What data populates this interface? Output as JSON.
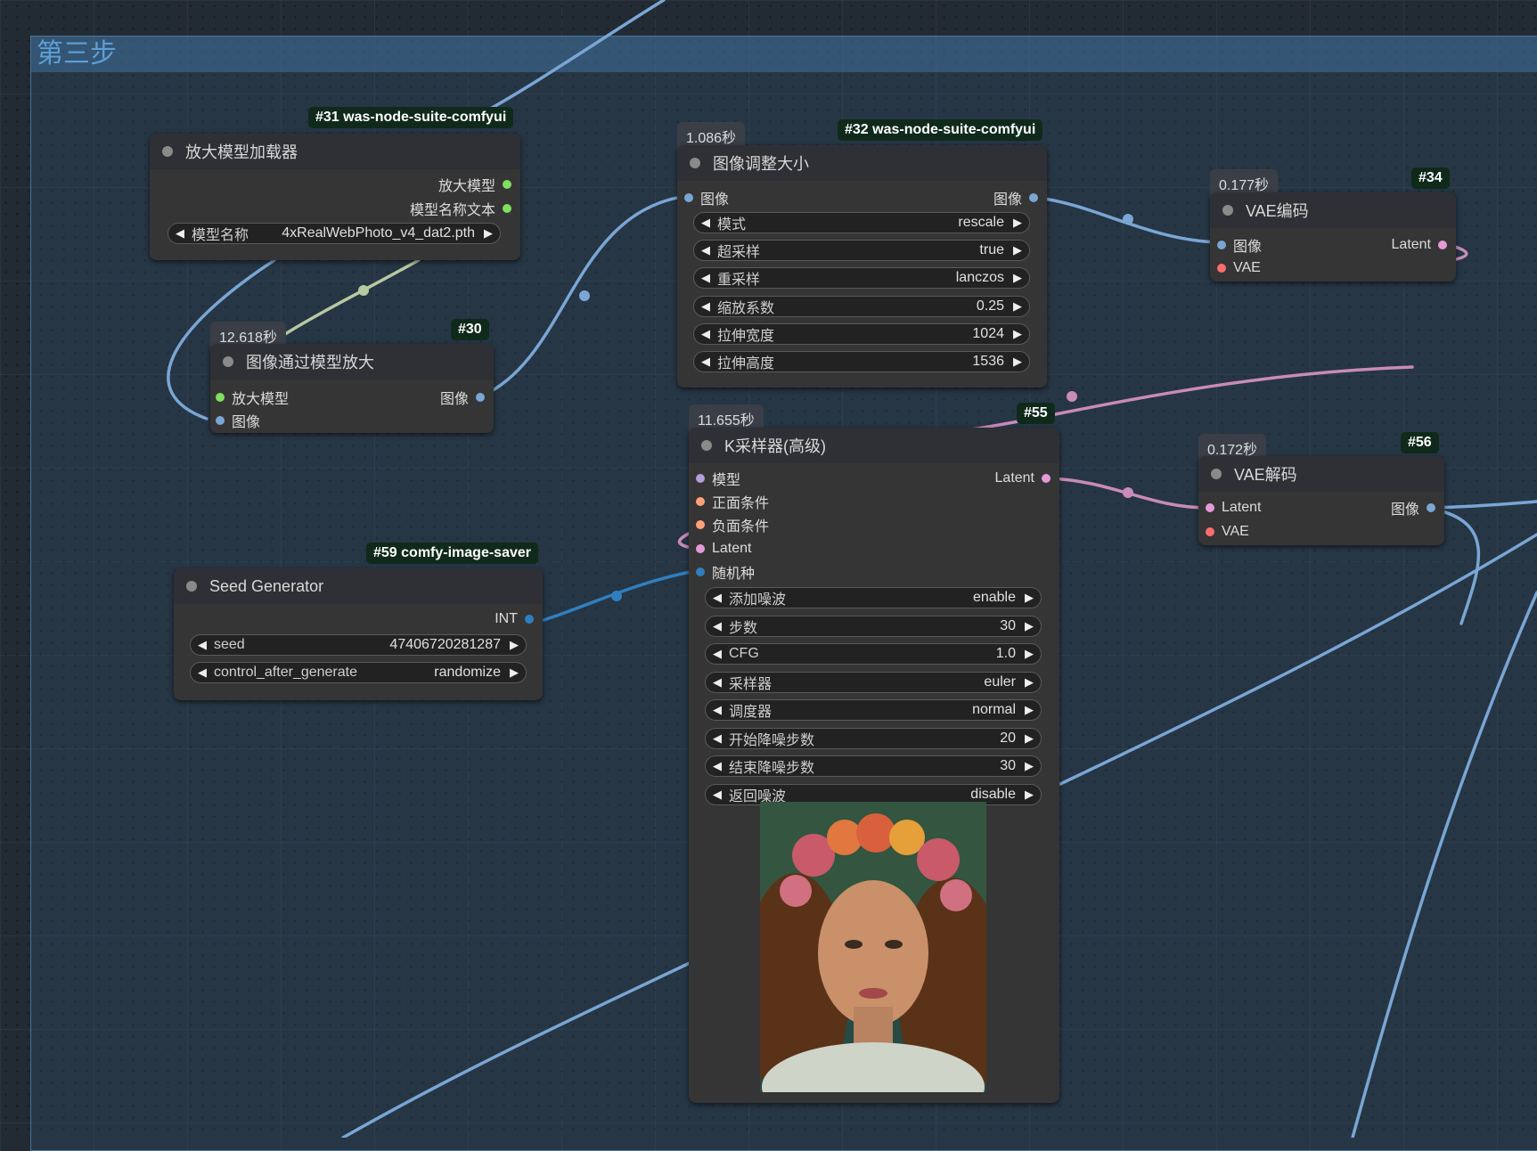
{
  "group": {
    "title": "第三步"
  },
  "colors": {
    "wire_image": "#7aa6d4",
    "wire_latent": "#c98bb9",
    "wire_upscale": "#b7c9a0",
    "wire_int": "#2f7fc0",
    "slot_green": "#7ee05f",
    "slot_image": "#7aa6d4",
    "slot_vae": "#ff6e6e",
    "slot_latent": "#e39ad6",
    "slot_model": "#b39ddb",
    "slot_cond": "#ffa07a",
    "slot_int": "#2f7fc0"
  },
  "nodes": {
    "upscale_loader": {
      "badge": "#31 was-node-suite-comfyui",
      "title": "放大模型加载器",
      "outputs": [
        "放大模型",
        "模型名称文本"
      ],
      "widgets": [
        {
          "label": "模型名称",
          "value": "4xRealWebPhoto_v4_dat2.pth"
        }
      ]
    },
    "upscale_with_model": {
      "badge": "#30",
      "timing": "12.618秒",
      "title": "图像通过模型放大",
      "inputs": [
        "放大模型",
        "图像"
      ],
      "outputs": [
        "图像"
      ]
    },
    "image_resize": {
      "badge": "#32 was-node-suite-comfyui",
      "timing": "1.086秒",
      "title": "图像调整大小",
      "inputs": [
        "图像"
      ],
      "outputs": [
        "图像"
      ],
      "widgets": [
        {
          "label": "模式",
          "value": "rescale"
        },
        {
          "label": "超采样",
          "value": "true"
        },
        {
          "label": "重采样",
          "value": "lanczos"
        },
        {
          "label": "缩放系数",
          "value": "0.25"
        },
        {
          "label": "拉伸宽度",
          "value": "1024"
        },
        {
          "label": "拉伸高度",
          "value": "1536"
        }
      ]
    },
    "vae_encode": {
      "badge": "#34",
      "timing": "0.177秒",
      "title": "VAE编码",
      "inputs": [
        "图像",
        "VAE"
      ],
      "outputs": [
        "Latent"
      ]
    },
    "ksampler": {
      "badge": "#55",
      "timing": "11.655秒",
      "title": "K采样器(高级)",
      "inputs": [
        "模型",
        "正面条件",
        "负面条件",
        "Latent",
        "随机种"
      ],
      "outputs": [
        "Latent"
      ],
      "widgets": [
        {
          "label": "添加噪波",
          "value": "enable"
        },
        {
          "label": "步数",
          "value": "30"
        },
        {
          "label": "CFG",
          "value": "1.0"
        },
        {
          "label": "采样器",
          "value": "euler"
        },
        {
          "label": "调度器",
          "value": "normal"
        },
        {
          "label": "开始降噪步数",
          "value": "20"
        },
        {
          "label": "结束降噪步数",
          "value": "30"
        },
        {
          "label": "返回噪波",
          "value": "disable"
        }
      ]
    },
    "vae_decode": {
      "badge": "#56",
      "timing": "0.172秒",
      "title": "VAE解码",
      "inputs": [
        "Latent",
        "VAE"
      ],
      "outputs": [
        "图像"
      ]
    },
    "seed_generator": {
      "badge": "#59 comfy-image-saver",
      "title": "Seed Generator",
      "outputs": [
        "INT"
      ],
      "widgets": [
        {
          "label": "seed",
          "value": "47406720281287"
        },
        {
          "label": "control_after_generate",
          "value": "randomize"
        }
      ]
    }
  }
}
